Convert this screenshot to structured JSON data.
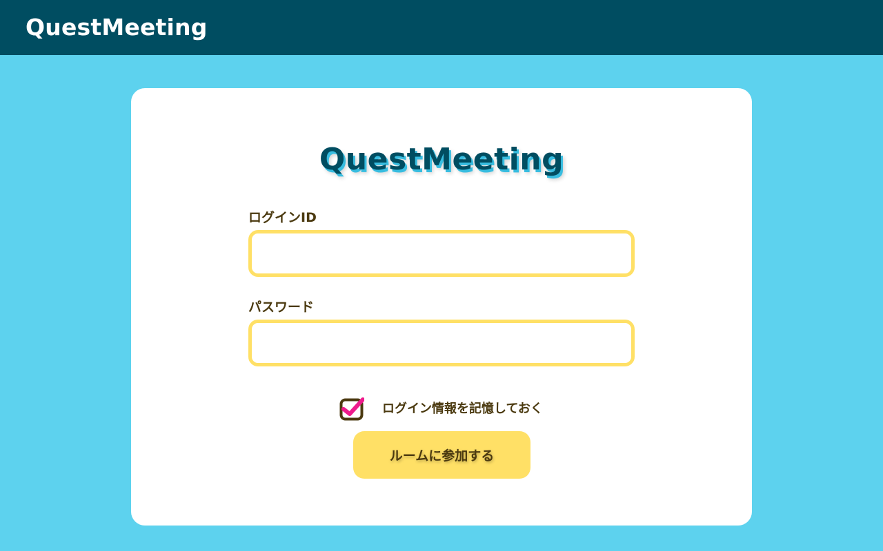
{
  "header": {
    "brand": "QuestMeeting"
  },
  "login_card": {
    "logo_text": "QuestMeeting",
    "login_id": {
      "label": "ログインID",
      "value": "",
      "placeholder": ""
    },
    "password": {
      "label": "パスワード",
      "value": "",
      "placeholder": ""
    },
    "remember": {
      "label": "ログイン情報を記憶しておく",
      "checked": true
    },
    "submit_label": "ルームに参加する"
  },
  "colors": {
    "header_bg": "#004d61",
    "page_bg": "#5dd2ee",
    "card_bg": "#ffffff",
    "accent_yellow": "#ffe066",
    "text_brown": "#4b3a10",
    "checkmark_pink": "#ee1b8c",
    "logo_shadow": "#38bde0"
  }
}
